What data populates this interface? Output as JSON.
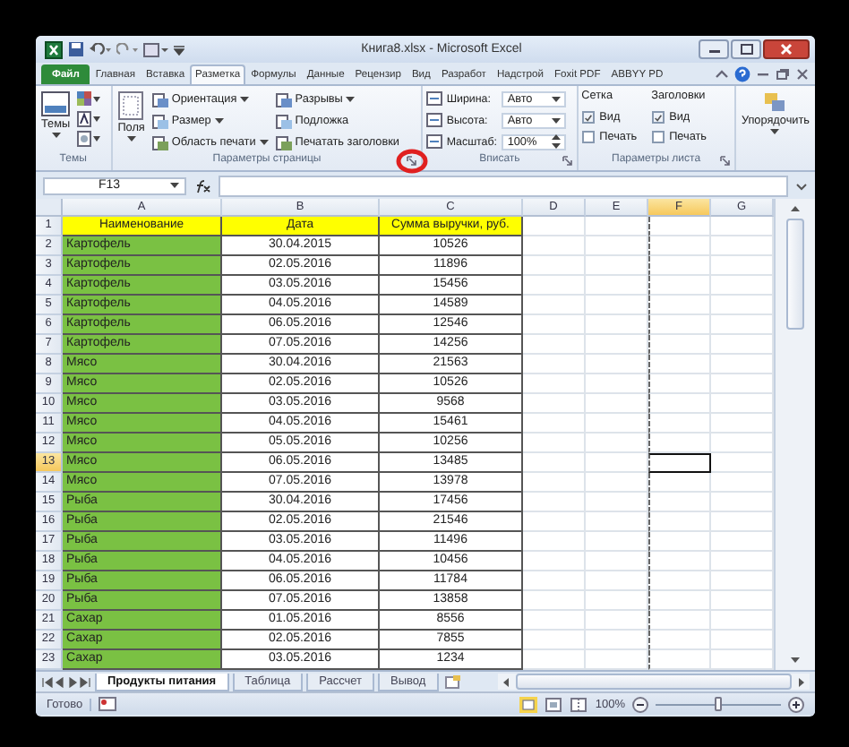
{
  "window": {
    "title": "Книга8.xlsx - Microsoft Excel"
  },
  "ribbon_tabs": [
    {
      "label": "Файл",
      "kind": "file",
      "selected": false
    },
    {
      "label": "Главная",
      "kind": "tab",
      "selected": false
    },
    {
      "label": "Вставка",
      "kind": "tab",
      "selected": false
    },
    {
      "label": "Разметка",
      "kind": "tab",
      "selected": true
    },
    {
      "label": "Формулы",
      "kind": "tab",
      "selected": false
    },
    {
      "label": "Данные",
      "kind": "tab",
      "selected": false
    },
    {
      "label": "Рецензир",
      "kind": "tab",
      "selected": false
    },
    {
      "label": "Вид",
      "kind": "tab",
      "selected": false
    },
    {
      "label": "Разработ",
      "kind": "tab",
      "selected": false
    },
    {
      "label": "Надстрой",
      "kind": "tab",
      "selected": false
    },
    {
      "label": "Foxit PDF",
      "kind": "tab",
      "selected": false
    },
    {
      "label": "ABBYY PD",
      "kind": "tab",
      "selected": false
    }
  ],
  "themes_group": {
    "label": "Темы",
    "button": "Темы"
  },
  "page_setup_group": {
    "label": "Параметры страницы",
    "margins": "Поля",
    "commands": [
      {
        "label": "Ориентация",
        "dropdown": true
      },
      {
        "label": "Размер",
        "dropdown": true
      },
      {
        "label": "Область печати",
        "dropdown": true
      },
      {
        "label": "Разрывы",
        "dropdown": true
      },
      {
        "label": "Подложка",
        "dropdown": false
      },
      {
        "label": "Печатать заголовки",
        "dropdown": false
      }
    ]
  },
  "scale_group": {
    "label": "Вписать",
    "fields": [
      {
        "label": "Ширина:",
        "value": "Авто",
        "kind": "dropdown"
      },
      {
        "label": "Высота:",
        "value": "Авто",
        "kind": "dropdown"
      },
      {
        "label": "Масштаб:",
        "value": "100%",
        "kind": "spinner"
      }
    ]
  },
  "sheet_options_group": {
    "label": "Параметры листа",
    "sections": [
      {
        "title": "Сетка",
        "options": [
          {
            "label": "Вид",
            "checked": true
          },
          {
            "label": "Печать",
            "checked": false
          }
        ]
      },
      {
        "title": "Заголовки",
        "options": [
          {
            "label": "Вид",
            "checked": true
          },
          {
            "label": "Печать",
            "checked": false
          }
        ]
      }
    ]
  },
  "arrange_button": {
    "label": "Упорядочить"
  },
  "name_box": {
    "value": "F13"
  },
  "columns": [
    {
      "label": "A",
      "selected": false
    },
    {
      "label": "B",
      "selected": false
    },
    {
      "label": "C",
      "selected": false
    },
    {
      "label": "D",
      "selected": false
    },
    {
      "label": "E",
      "selected": false
    },
    {
      "label": "F",
      "selected": true
    },
    {
      "label": "G",
      "selected": false
    }
  ],
  "header_row": {
    "number": "1",
    "cells": [
      "Наименование",
      "Дата",
      "Сумма выручки, руб."
    ]
  },
  "rows": [
    {
      "number": "2",
      "name": "Картофель",
      "date": "30.04.2015",
      "amount": "10526",
      "selected": false
    },
    {
      "number": "3",
      "name": "Картофель",
      "date": "02.05.2016",
      "amount": "11896",
      "selected": false
    },
    {
      "number": "4",
      "name": "Картофель",
      "date": "03.05.2016",
      "amount": "15456",
      "selected": false
    },
    {
      "number": "5",
      "name": "Картофель",
      "date": "04.05.2016",
      "amount": "14589",
      "selected": false
    },
    {
      "number": "6",
      "name": "Картофель",
      "date": "06.05.2016",
      "amount": "12546",
      "selected": false
    },
    {
      "number": "7",
      "name": "Картофель",
      "date": "07.05.2016",
      "amount": "14256",
      "selected": false
    },
    {
      "number": "8",
      "name": "Мясо",
      "date": "30.04.2016",
      "amount": "21563",
      "selected": false
    },
    {
      "number": "9",
      "name": "Мясо",
      "date": "02.05.2016",
      "amount": "10526",
      "selected": false
    },
    {
      "number": "10",
      "name": "Мясо",
      "date": "03.05.2016",
      "amount": "9568",
      "selected": false
    },
    {
      "number": "11",
      "name": "Мясо",
      "date": "04.05.2016",
      "amount": "15461",
      "selected": false
    },
    {
      "number": "12",
      "name": "Мясо",
      "date": "05.05.2016",
      "amount": "10256",
      "selected": false
    },
    {
      "number": "13",
      "name": "Мясо",
      "date": "06.05.2016",
      "amount": "13485",
      "selected": true
    },
    {
      "number": "14",
      "name": "Мясо",
      "date": "07.05.2016",
      "amount": "13978",
      "selected": false
    },
    {
      "number": "15",
      "name": "Рыба",
      "date": "30.04.2016",
      "amount": "17456",
      "selected": false
    },
    {
      "number": "16",
      "name": "Рыба",
      "date": "02.05.2016",
      "amount": "21546",
      "selected": false
    },
    {
      "number": "17",
      "name": "Рыба",
      "date": "03.05.2016",
      "amount": "11496",
      "selected": false
    },
    {
      "number": "18",
      "name": "Рыба",
      "date": "04.05.2016",
      "amount": "10456",
      "selected": false
    },
    {
      "number": "19",
      "name": "Рыба",
      "date": "06.05.2016",
      "amount": "11784",
      "selected": false
    },
    {
      "number": "20",
      "name": "Рыба",
      "date": "07.05.2016",
      "amount": "13858",
      "selected": false
    },
    {
      "number": "21",
      "name": "Сахар",
      "date": "01.05.2016",
      "amount": "8556",
      "selected": false
    },
    {
      "number": "22",
      "name": "Сахар",
      "date": "02.05.2016",
      "amount": "7855",
      "selected": false
    },
    {
      "number": "23",
      "name": "Сахар",
      "date": "03.05.2016",
      "amount": "1234",
      "selected": false
    }
  ],
  "sheet_tabs": [
    {
      "label": "Продукты питания",
      "selected": true
    },
    {
      "label": "Таблица",
      "selected": false
    },
    {
      "label": "Рассчет",
      "selected": false
    },
    {
      "label": "Вывод",
      "selected": false
    }
  ],
  "status_bar": {
    "text": "Готово",
    "zoom": "100%",
    "level": 0.5
  }
}
